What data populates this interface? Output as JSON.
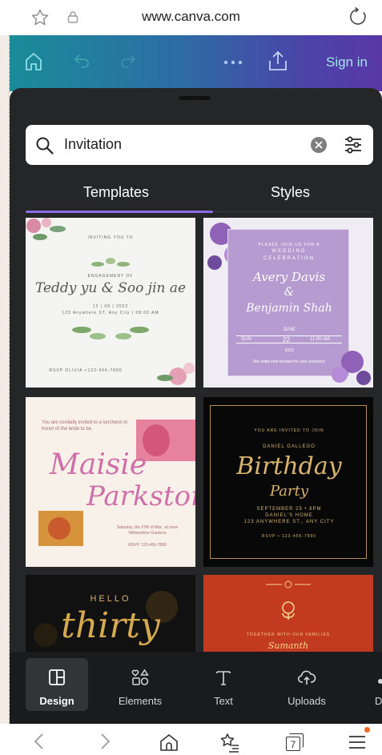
{
  "browser": {
    "url": "www.canva.com",
    "tab_count": "7"
  },
  "header": {
    "sign_in": "Sign in"
  },
  "search": {
    "value": "Invitation"
  },
  "tabs": [
    {
      "label": "Templates",
      "active": true
    },
    {
      "label": "Styles",
      "active": false
    }
  ],
  "templates": {
    "card1": {
      "top": "INVITING YOU TO",
      "sub": "ENGAGEMENT OF",
      "names": "Teddy yu & Soo jin ae",
      "date": "12 | 08 | 2022",
      "address": "123 Anywhere ST, Any City | 08:00 AM",
      "rsvp": "RSVP OLIVIA +123-456-7890"
    },
    "card2": {
      "line1": "PLEASE JOIN US FOR A",
      "line2": "WEDDING",
      "line3": "CELEBRATION",
      "name1": "Avery Davis",
      "amp": "&",
      "name2": "Benjamin Shah",
      "month": "JUNE",
      "day_left": "SUN",
      "day": "22",
      "time": "11:00 AM",
      "year": "2023",
      "footer": "We really look forward for your presence"
    },
    "card3": {
      "intro": "You are cordially invited to a luncheon in honor of the bride to be",
      "name1": "Maisie",
      "name2": "Parkston",
      "details": "Saturday, the 27th of Mar., at noon Willowshine Gardens",
      "rsvp": "RSVP: 123-456-7890"
    },
    "card4": {
      "top": "YOU ARE INVITED TO JOIN",
      "host": "DANIEL GALLEGO",
      "title1": "Birthday",
      "title2": "Party",
      "date": "SEPTEMBER 25 • 8PM",
      "place": "DANIEL'S HOME",
      "address": "123 ANYWHERE ST., ANY CITY",
      "rsvp": "RSVP • 123-456-7890"
    },
    "card5": {
      "hello": "HELLO",
      "title": "thirty"
    },
    "card6": {
      "line": "TOGETHER WITH OUR FAMILIES",
      "name": "Sumanth"
    }
  },
  "tools": [
    {
      "label": "Design",
      "icon": "design-icon",
      "active": true
    },
    {
      "label": "Elements",
      "icon": "elements-icon",
      "active": false
    },
    {
      "label": "Text",
      "icon": "text-icon",
      "active": false
    },
    {
      "label": "Uploads",
      "icon": "uploads-icon",
      "active": false
    },
    {
      "label": "D",
      "icon": "draw-icon",
      "active": false
    }
  ],
  "colors": {
    "panel": "#252627",
    "accent": "#8b6be8",
    "header_start": "#1a8c99",
    "header_end": "#5a38a6"
  }
}
